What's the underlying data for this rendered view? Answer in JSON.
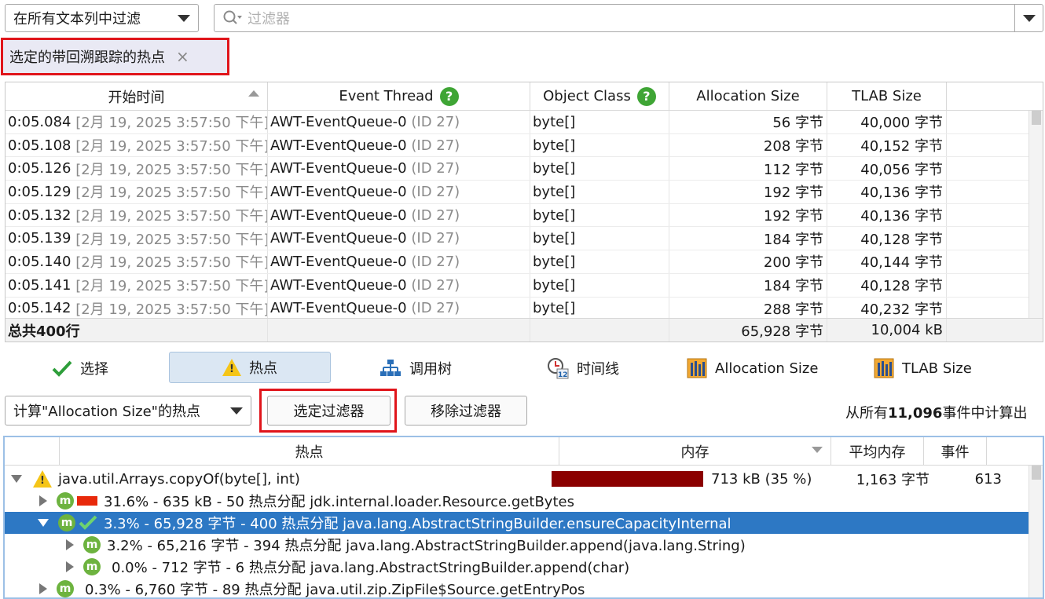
{
  "filter_bar": {
    "scope_select": "在所有文本列中过滤",
    "search_placeholder": "过滤器"
  },
  "active_filter_chip": {
    "label": "选定的带回溯跟踪的热点",
    "close": "×"
  },
  "events_table": {
    "columns": [
      "开始时间",
      "Event Thread",
      "Object Class",
      "Allocation Size",
      "TLAB Size"
    ],
    "rows": [
      {
        "time": "0:05.084",
        "date": "[2月 19, 2025 3:57:50 下午]",
        "thread": "AWT-EventQueue-0",
        "tid": "(ID 27)",
        "cls": "byte[]",
        "alloc": "56 字节",
        "tlab": "40,000 字节"
      },
      {
        "time": "0:05.108",
        "date": "[2月 19, 2025 3:57:50 下午]",
        "thread": "AWT-EventQueue-0",
        "tid": "(ID 27)",
        "cls": "byte[]",
        "alloc": "208 字节",
        "tlab": "40,152 字节"
      },
      {
        "time": "0:05.126",
        "date": "[2月 19, 2025 3:57:50 下午]",
        "thread": "AWT-EventQueue-0",
        "tid": "(ID 27)",
        "cls": "byte[]",
        "alloc": "112 字节",
        "tlab": "40,056 字节"
      },
      {
        "time": "0:05.129",
        "date": "[2月 19, 2025 3:57:50 下午]",
        "thread": "AWT-EventQueue-0",
        "tid": "(ID 27)",
        "cls": "byte[]",
        "alloc": "192 字节",
        "tlab": "40,136 字节"
      },
      {
        "time": "0:05.132",
        "date": "[2月 19, 2025 3:57:50 下午]",
        "thread": "AWT-EventQueue-0",
        "tid": "(ID 27)",
        "cls": "byte[]",
        "alloc": "192 字节",
        "tlab": "40,136 字节"
      },
      {
        "time": "0:05.139",
        "date": "[2月 19, 2025 3:57:50 下午]",
        "thread": "AWT-EventQueue-0",
        "tid": "(ID 27)",
        "cls": "byte[]",
        "alloc": "184 字节",
        "tlab": "40,128 字节"
      },
      {
        "time": "0:05.140",
        "date": "[2月 19, 2025 3:57:50 下午]",
        "thread": "AWT-EventQueue-0",
        "tid": "(ID 27)",
        "cls": "byte[]",
        "alloc": "200 字节",
        "tlab": "40,144 字节"
      },
      {
        "time": "0:05.141",
        "date": "[2月 19, 2025 3:57:50 下午]",
        "thread": "AWT-EventQueue-0",
        "tid": "(ID 27)",
        "cls": "byte[]",
        "alloc": "184 字节",
        "tlab": "40,128 字节"
      },
      {
        "time": "0:05.142",
        "date": "[2月 19, 2025 3:57:50 下午]",
        "thread": "AWT-EventQueue-0",
        "tid": "(ID 27)",
        "cls": "byte[]",
        "alloc": "288 字节",
        "tlab": "40,232 字节"
      }
    ],
    "total_label": "总共",
    "total_count": "400行",
    "total_alloc": "65,928 字节",
    "total_tlab": "10,004 kB"
  },
  "view_tabs": [
    "选择",
    "热点",
    "调用树",
    "时间线",
    "Allocation Size",
    "TLAB Size"
  ],
  "controls": {
    "calc_select": "计算\"Allocation Size\"的热点",
    "apply_filter": "选定过滤器",
    "remove_filter": "移除过滤器",
    "computed_prefix": "从所有",
    "computed_count": "11,096",
    "computed_suffix": "事件中计算出"
  },
  "hotspot_tree": {
    "columns": [
      "热点",
      "内存",
      "平均内存",
      "事件"
    ],
    "root": {
      "label": "java.util.Arrays.copyOf(byte[], int)",
      "mem": "713 kB (35 %)",
      "mem_fraction": 0.35,
      "avg": "1,163 字节",
      "events": "613"
    },
    "children": [
      {
        "label": "31.6% - 635 kB - 50 热点分配 jdk.internal.loader.Resource.getBytes"
      },
      {
        "label": "3.3% - 65,928 字节 - 400 热点分配 java.lang.AbstractStringBuilder.ensureCapacityInternal"
      },
      {
        "label": "3.2% - 65,216 字节 - 394 热点分配 java.lang.AbstractStringBuilder.append(java.lang.String)"
      },
      {
        "label": "0.0% - 712 字节 - 6 热点分配 java.lang.AbstractStringBuilder.append(char)"
      },
      {
        "label": "0.3% - 6,760 字节 - 89 热点分配 java.util.zip.ZipFile$Source.getEntryPos"
      }
    ]
  },
  "colors": {
    "selection": "#2d78c4",
    "mem_bar": "#8b0000",
    "highlight": "#e0151b",
    "method_icon": "#6db33f"
  }
}
